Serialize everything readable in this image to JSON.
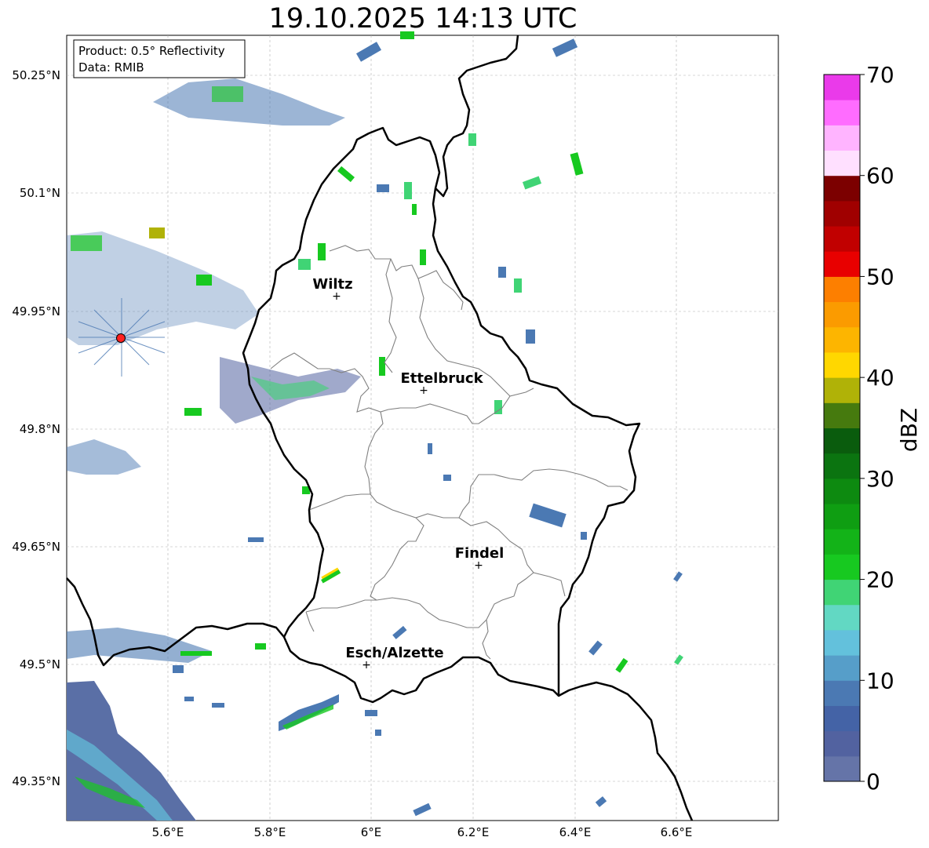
{
  "title": "19.10.2025 14:13 UTC",
  "infobox": {
    "product": "Product: 0.5° Reflectivity",
    "data": "Data: RMIB"
  },
  "axes": {
    "lon_ticks": [
      "5.6°E",
      "5.8°E",
      "6°E",
      "6.2°E",
      "6.4°E",
      "6.6°E"
    ],
    "lat_ticks": [
      "50.25°N",
      "50.1°N",
      "49.95°N",
      "49.8°N",
      "49.65°N",
      "49.5°N",
      "49.35°N"
    ]
  },
  "cities": [
    {
      "name": "Wiltz"
    },
    {
      "name": "Ettelbruck"
    },
    {
      "name": "Findel"
    },
    {
      "name": "Esch/Alzette"
    }
  ],
  "colorbar": {
    "label": "dBZ",
    "ticks": [
      "0",
      "10",
      "20",
      "30",
      "40",
      "50",
      "60",
      "70"
    ],
    "colors": [
      "#6574a8",
      "#5262a0",
      "#4463a6",
      "#4b79b3",
      "#569ec9",
      "#63c1dc",
      "#62d8c3",
      "#40d475",
      "#17c920",
      "#13b318",
      "#0f9e12",
      "#0d8a10",
      "#0b7410",
      "#0a5c0d",
      "#467a0e",
      "#b0b207",
      "#ffd700",
      "#fdb500",
      "#fb9b00",
      "#fd7f00",
      "#e80000",
      "#c10000",
      "#a00000",
      "#7c0000",
      "#ffe0ff",
      "#ffb4ff",
      "#ff6cff",
      "#ea3aea"
    ]
  },
  "radar_site_color": "#ff2020",
  "border_color": "#000000",
  "canton_color": "#808080"
}
